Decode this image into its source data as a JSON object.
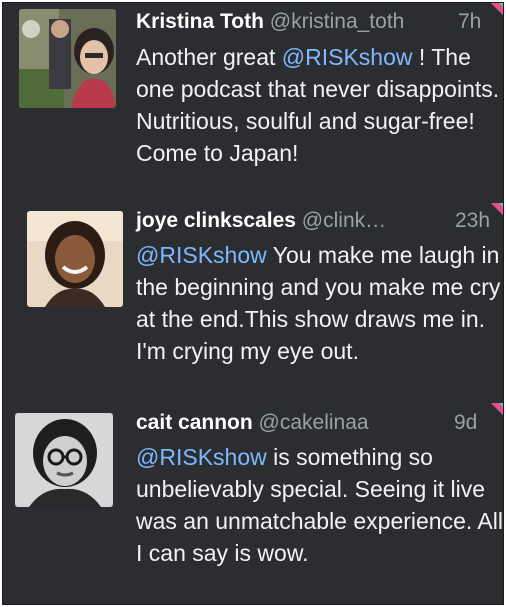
{
  "colors": {
    "background": "#2b2d31",
    "name_text": "#ffffff",
    "muted_text": "#9aa1a9",
    "body_text": "#f2f2f2",
    "mention": "#7db9ff",
    "corner_pink": "#e84d8a",
    "corner_green": "#5ad1a6"
  },
  "tweets": [
    {
      "name": "Kristina Toth",
      "handle": "@kristina_toth",
      "time": "7h",
      "mention": "@RISKshow",
      "text_before": "Another great ",
      "text_after": " ! The one podcast that never disappoints. Nutritious, soulful and sugar-free! Come to Japan!",
      "avatar_icon": "user-avatar-photo"
    },
    {
      "name": "joye clinkscales",
      "handle": "@clink…",
      "time": "23h",
      "mention": "@RISKshow",
      "text_before": "",
      "text_after": " You make me laugh in the beginning and you make me cry at the end.This show draws me in. I'm crying my eye out.",
      "avatar_icon": "user-avatar-photo"
    },
    {
      "name": "cait cannon",
      "handle": "@cakelinaa",
      "time": "9d",
      "mention": "@RISKshow",
      "text_before": "",
      "text_after": " is something so unbelievably special. Seeing it live was an unmatchable experience. All I can say is wow.",
      "avatar_icon": "user-avatar-photo"
    }
  ]
}
